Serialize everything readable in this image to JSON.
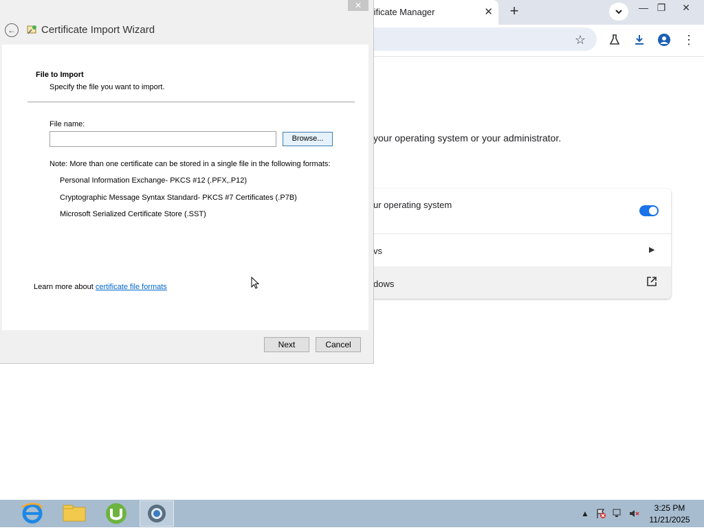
{
  "browser": {
    "tab_title": "tificate Manager",
    "tab_close": "✕",
    "new_tab": "+",
    "tab_search": "⌄",
    "minimize": "—",
    "restore": "❐",
    "close": "✕",
    "content_text": "your operating system or your administrator.",
    "rows": [
      {
        "label": "ur operating system"
      },
      {
        "label": "vs"
      },
      {
        "label": "dows"
      }
    ]
  },
  "wizard": {
    "close": "✕",
    "back": "←",
    "title": "Certificate Import Wizard",
    "section_title": "File to Import",
    "section_subtitle": "Specify the file you want to import.",
    "file_name_label": "File name:",
    "file_name_value": "",
    "browse_label": "Browse...",
    "note": "Note:  More than one certificate can be stored in a single file in the following formats:",
    "formats": [
      "Personal Information Exchange- PKCS #12 (.PFX,.P12)",
      "Cryptographic Message Syntax Standard- PKCS #7 Certificates (.P7B)",
      "Microsoft Serialized Certificate Store (.SST)"
    ],
    "learn_more_prefix": "Learn more about ",
    "learn_more_link": "certificate file formats",
    "next_label": "Next",
    "cancel_label": "Cancel"
  },
  "taskbar": {
    "apps": [
      "internet-explorer-icon",
      "file-explorer-icon",
      "utorrent-icon",
      "chrome-icon"
    ],
    "tray_up": "▲",
    "time": "3:25 PM",
    "date": "11/21/2025"
  },
  "colors": {
    "accent": "#1a73e8",
    "link": "#0066cc",
    "taskbar": "#a7bccf"
  }
}
